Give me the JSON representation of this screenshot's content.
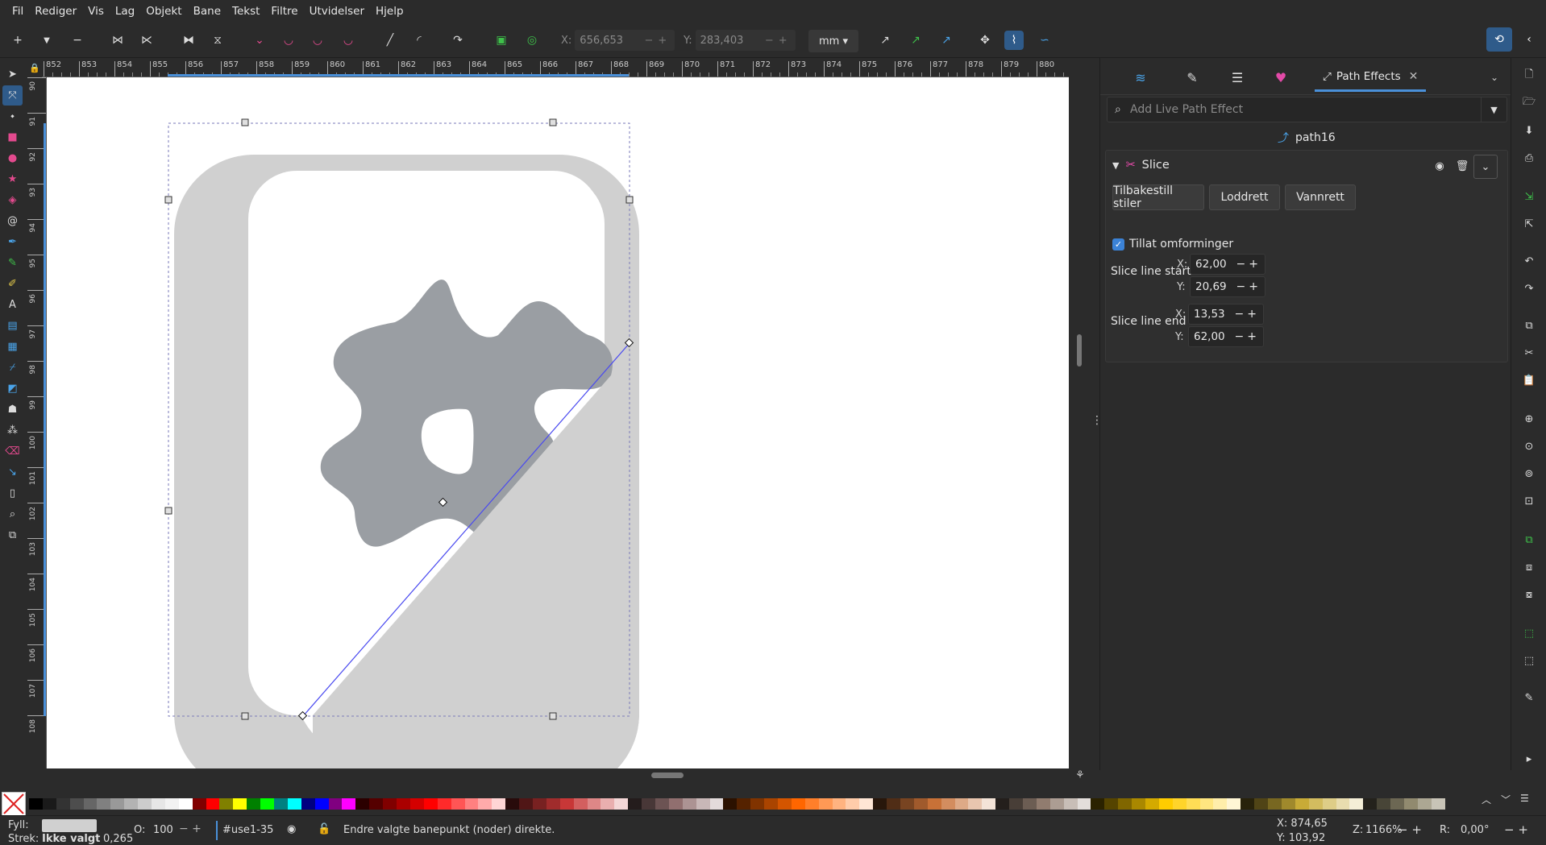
{
  "menu": [
    "Fil",
    "Rediger",
    "Vis",
    "Lag",
    "Objekt",
    "Bane",
    "Tekst",
    "Filtre",
    "Utvidelser",
    "Hjelp"
  ],
  "toolctrl": {
    "x_label": "X:",
    "x_value": "656,653",
    "y_label": "Y:",
    "y_value": "283,403",
    "unit": "mm"
  },
  "hruler_ticks": [
    "852",
    "853",
    "854",
    "855",
    "856",
    "857",
    "858",
    "859",
    "860",
    "861",
    "862",
    "863",
    "864",
    "865",
    "866",
    "867",
    "868",
    "869",
    "870",
    "871",
    "872",
    "873",
    "874",
    "875",
    "876",
    "877",
    "878",
    "879",
    "880"
  ],
  "vruler_ticks": [
    "90",
    "91",
    "92",
    "93",
    "94",
    "95",
    "96",
    "97",
    "98",
    "99",
    "100",
    "101",
    "102",
    "103",
    "104",
    "105",
    "106",
    "107",
    "108"
  ],
  "dock": {
    "tab_label": "Path Effects",
    "search_placeholder": "Add Live Path Effect",
    "path_name": "path16",
    "effect_name": "Slice",
    "buttons": {
      "reset": "Tilbakestill stiler",
      "vertical": "Loddrett",
      "horizontal": "Vannrett"
    },
    "allow_transforms": "Tillat omforminger",
    "slice_start": {
      "label": "Slice line start",
      "x": "62,00",
      "y": "20,69"
    },
    "slice_end": {
      "label": "Slice line end",
      "x": "13,53",
      "y": "62,00"
    },
    "x_label": "X:",
    "y_label": "Y:"
  },
  "statusbar": {
    "fill_label": "Fyll:",
    "stroke_label": "Strek:",
    "stroke_value": "Ikke valgt",
    "stroke_width": "0,265",
    "opacity_label": "O:",
    "opacity_value": "100",
    "layer_name": "#use1-35",
    "message": "Endre valgte banepunkt (noder) direkte.",
    "cursor_x": "X: 874,65",
    "cursor_y": "Y: 103,92",
    "zoom_label": "Z:",
    "zoom_value": "1166%",
    "rotation_label": "R:",
    "rotation_value": "0,00°"
  },
  "colors": {
    "accent": "#2f5b8a",
    "frame_gray": "#d0d0d0",
    "gear_gray": "#9a9ea3",
    "path_blue": "#4a4af0"
  },
  "palette": [
    "#000000",
    "#1a1a1a",
    "#333333",
    "#4d4d4d",
    "#666666",
    "#808080",
    "#999999",
    "#b3b3b3",
    "#cccccc",
    "#e6e6e6",
    "#f2f2f2",
    "#ffffff",
    "#800000",
    "#ff0000",
    "#808000",
    "#ffff00",
    "#008000",
    "#00ff00",
    "#008080",
    "#00ffff",
    "#000080",
    "#0000ff",
    "#800080",
    "#ff00ff",
    "#2b0000",
    "#550000",
    "#800000",
    "#aa0000",
    "#d40000",
    "#ff0000",
    "#ff2a2a",
    "#ff5555",
    "#ff8080",
    "#ffaaaa",
    "#ffd5d5",
    "#280b0b",
    "#501616",
    "#782121",
    "#a02c2c",
    "#c83737",
    "#d35f5f",
    "#de8787",
    "#e9afaf",
    "#f4d7d7",
    "#241c1c",
    "#483737",
    "#6c5353",
    "#916f6f",
    "#ac9393",
    "#c8b7b7",
    "#e3dbdb",
    "#2b1100",
    "#552200",
    "#803300",
    "#aa4400",
    "#d45500",
    "#ff6600",
    "#ff7f2a",
    "#ff9955",
    "#ffb380",
    "#ffccaa",
    "#ffe6d5",
    "#28170b",
    "#502d16",
    "#784421",
    "#a05a2c",
    "#c87137",
    "#d38d5f",
    "#deaa87",
    "#e9c6af",
    "#f4e3d7",
    "#241f1c",
    "#483e37",
    "#6c5d53",
    "#917c6f",
    "#ac9d93",
    "#c8beb7",
    "#e3dedb",
    "#2b2200",
    "#554400",
    "#806600",
    "#aa8800",
    "#d4aa00",
    "#ffcc00",
    "#ffd42a",
    "#ffdd55",
    "#ffe680",
    "#ffeeaa",
    "#fff6d5",
    "#28220b",
    "#504416",
    "#786721",
    "#a0892c",
    "#c8ab37",
    "#d3bc5f",
    "#decd87",
    "#e9ddaf",
    "#f4eed7",
    "#24221c",
    "#484537",
    "#6c6753",
    "#918a6f",
    "#aca793",
    "#c8c4b7"
  ]
}
